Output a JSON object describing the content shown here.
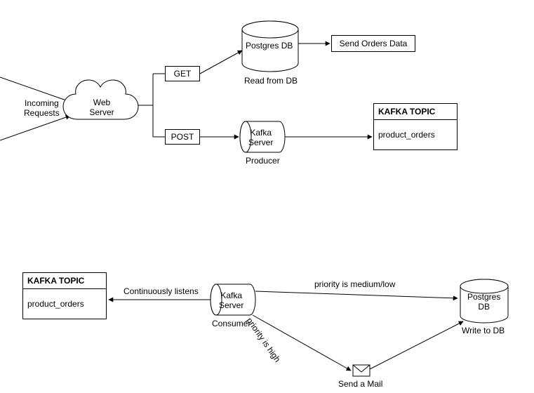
{
  "incoming_requests": "Incoming\nRequests",
  "web_server": "Web\nServer",
  "get": "GET",
  "post": "POST",
  "postgres_db_top": "Postgres DB",
  "read_from_db": "Read from DB",
  "send_orders": "Send Orders Data",
  "kafka_server_top": "Kafka\nServer",
  "producer": "Producer",
  "kafka_topic_title_top": "KAFKA TOPIC",
  "product_orders_top": "product_orders",
  "kafka_topic_title_bottom": "KAFKA TOPIC",
  "product_orders_bottom": "product_orders",
  "continuously_listens": "Continuously listens",
  "kafka_server_bottom": "Kafka\nServer",
  "consumer": "Consumer",
  "priority_medium_low": "priority is medium/low",
  "priority_high": "priority is high",
  "send_mail": "Send a Mail",
  "postgres_db_bottom": "Postgres\nDB",
  "write_to_db": "Write to DB"
}
